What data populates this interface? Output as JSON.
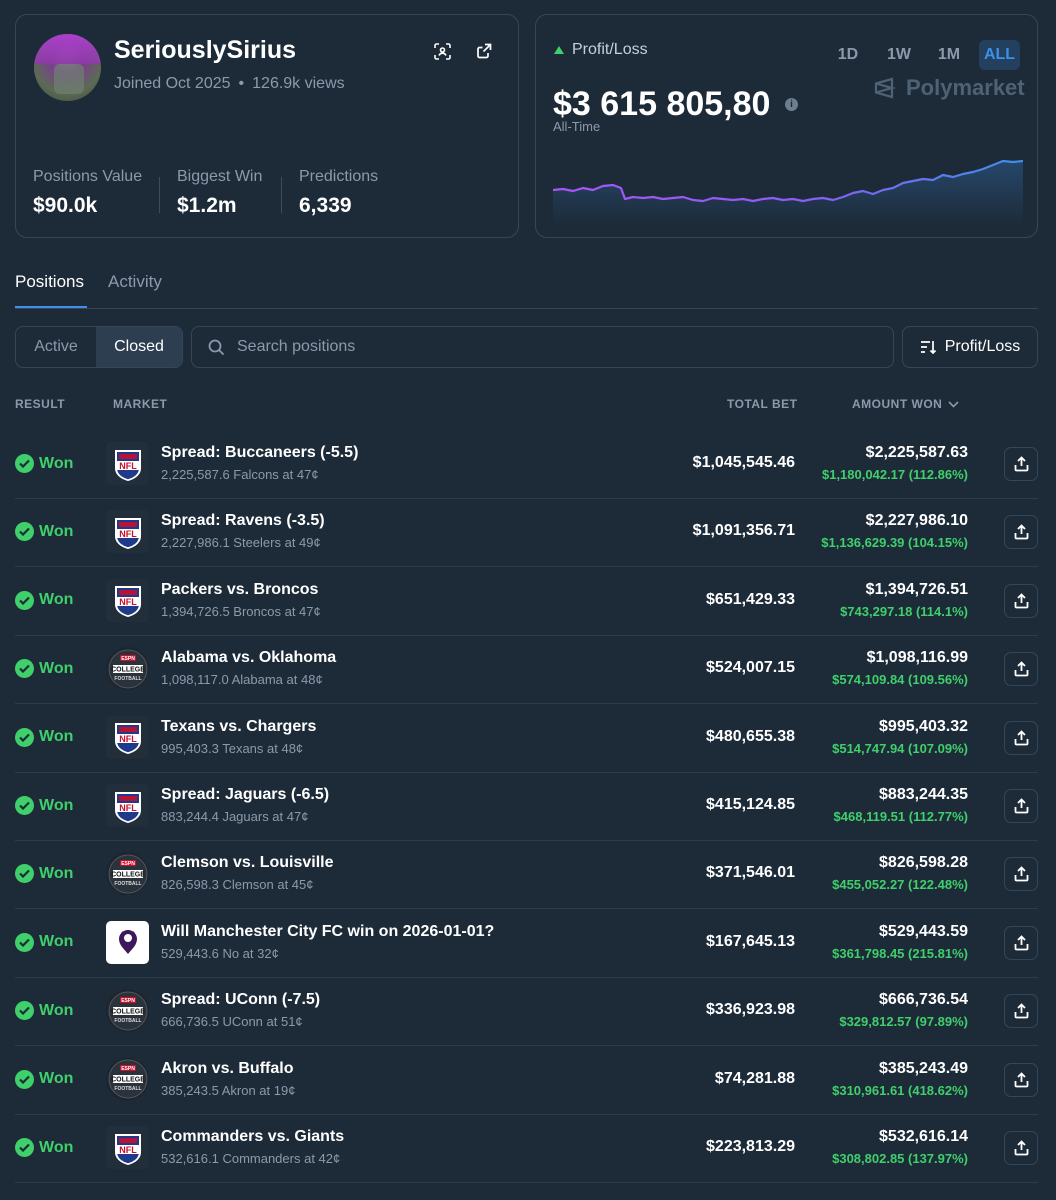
{
  "profile": {
    "username": "SeriouslySirius",
    "joined": "Joined Oct 2025",
    "views": "126.9k views",
    "stats": [
      {
        "label": "Positions Value",
        "value": "$90.0k"
      },
      {
        "label": "Biggest Win",
        "value": "$1.2m"
      },
      {
        "label": "Predictions",
        "value": "6,339"
      }
    ],
    "icons": [
      "scan-icon",
      "external-link-icon"
    ]
  },
  "pnl": {
    "label": "Profit/Loss",
    "value": "$3 615 805,80",
    "period": "All-Time",
    "timeframes": [
      "1D",
      "1W",
      "1M",
      "ALL"
    ],
    "active_timeframe": "ALL",
    "brand": "Polymarket",
    "colors": {
      "up": "#3fcf6b",
      "line_start": "#a855f7",
      "line_end": "#3d8fe8"
    }
  },
  "tabs": [
    {
      "label": "Positions",
      "active": true
    },
    {
      "label": "Activity",
      "active": false
    }
  ],
  "filters": {
    "segments": [
      "Active",
      "Closed"
    ],
    "active_segment": "Closed",
    "search_placeholder": "Search positions",
    "sort_label": "Profit/Loss"
  },
  "table": {
    "headers": {
      "result": "RESULT",
      "market": "MARKET",
      "total_bet": "TOTAL BET",
      "amount_won": "AMOUNT WON"
    },
    "rows": [
      {
        "result": "Won",
        "logo": "nfl",
        "title": "Spread: Buccaneers (-5.5)",
        "sub": "2,225,587.6 Falcons at 47¢",
        "bet": "$1,045,545.46",
        "won": "$2,225,587.63",
        "gain": "$1,180,042.17 (112.86%)"
      },
      {
        "result": "Won",
        "logo": "nfl",
        "title": "Spread: Ravens (-3.5)",
        "sub": "2,227,986.1 Steelers at 49¢",
        "bet": "$1,091,356.71",
        "won": "$2,227,986.10",
        "gain": "$1,136,629.39 (104.15%)"
      },
      {
        "result": "Won",
        "logo": "nfl",
        "title": "Packers vs. Broncos",
        "sub": "1,394,726.5 Broncos at 47¢",
        "bet": "$651,429.33",
        "won": "$1,394,726.51",
        "gain": "$743,297.18 (114.1%)"
      },
      {
        "result": "Won",
        "logo": "cfb",
        "title": "Alabama vs. Oklahoma",
        "sub": "1,098,117.0 Alabama at 48¢",
        "bet": "$524,007.15",
        "won": "$1,098,116.99",
        "gain": "$574,109.84 (109.56%)"
      },
      {
        "result": "Won",
        "logo": "nfl",
        "title": "Texans vs. Chargers",
        "sub": "995,403.3 Texans at 48¢",
        "bet": "$480,655.38",
        "won": "$995,403.32",
        "gain": "$514,747.94 (107.09%)"
      },
      {
        "result": "Won",
        "logo": "nfl",
        "title": "Spread: Jaguars (-6.5)",
        "sub": "883,244.4 Jaguars at 47¢",
        "bet": "$415,124.85",
        "won": "$883,244.35",
        "gain": "$468,119.51 (112.77%)"
      },
      {
        "result": "Won",
        "logo": "cfb",
        "title": "Clemson vs. Louisville",
        "sub": "826,598.3 Clemson at 45¢",
        "bet": "$371,546.01",
        "won": "$826,598.28",
        "gain": "$455,052.27 (122.48%)"
      },
      {
        "result": "Won",
        "logo": "epl",
        "title": "Will Manchester City FC win on 2026-01-01?",
        "sub": "529,443.6 No at 32¢",
        "bet": "$167,645.13",
        "won": "$529,443.59",
        "gain": "$361,798.45 (215.81%)"
      },
      {
        "result": "Won",
        "logo": "cfb",
        "title": "Spread: UConn (-7.5)",
        "sub": "666,736.5 UConn at 51¢",
        "bet": "$336,923.98",
        "won": "$666,736.54",
        "gain": "$329,812.57 (97.89%)"
      },
      {
        "result": "Won",
        "logo": "cfb",
        "title": "Akron vs. Buffalo",
        "sub": "385,243.5 Akron at 19¢",
        "bet": "$74,281.88",
        "won": "$385,243.49",
        "gain": "$310,961.61 (418.62%)"
      },
      {
        "result": "Won",
        "logo": "nfl",
        "title": "Commanders vs. Giants",
        "sub": "532,616.1 Commanders at 42¢",
        "bet": "$223,813.29",
        "won": "$532,616.14",
        "gain": "$308,802.85 (137.97%)"
      }
    ]
  }
}
